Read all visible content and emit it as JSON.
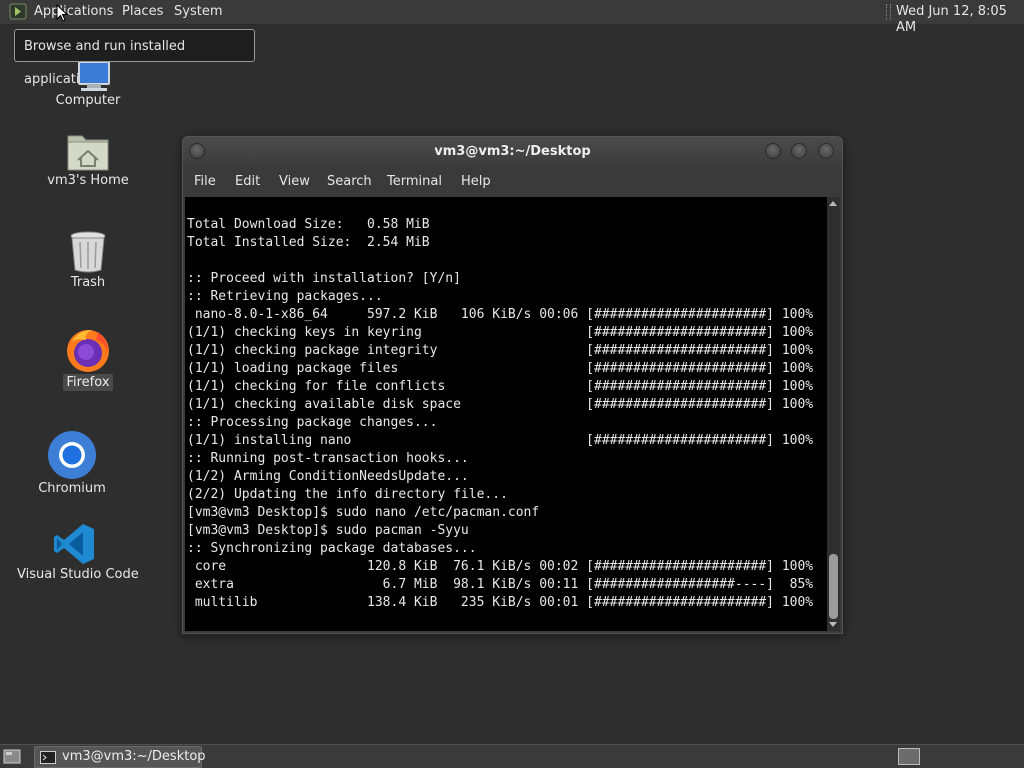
{
  "top_panel": {
    "menus": [
      "Applications",
      "Places",
      "System"
    ],
    "clock": "Wed Jun 12,  8:05 AM"
  },
  "tooltip": {
    "text": "Browse and run installed applications"
  },
  "desktop_icons": [
    {
      "label": "Computer",
      "icon": "computer-icon"
    },
    {
      "label": "vm3's Home",
      "icon": "home-folder-icon"
    },
    {
      "label": "Trash",
      "icon": "trash-icon"
    },
    {
      "label": "Firefox",
      "icon": "firefox-icon",
      "selected": true
    },
    {
      "label": "Chromium",
      "icon": "chromium-icon"
    },
    {
      "label": "Visual Studio Code",
      "icon": "vscode-icon"
    }
  ],
  "terminal_window": {
    "title": "vm3@vm3:~/Desktop",
    "menu": [
      "File",
      "Edit",
      "View",
      "Search",
      "Terminal",
      "Help"
    ],
    "lines": [
      "Total Download Size:   0.58 MiB",
      "Total Installed Size:  2.54 MiB",
      "",
      ":: Proceed with installation? [Y/n]",
      ":: Retrieving packages...",
      " nano-8.0-1-x86_64     597.2 KiB   106 KiB/s 00:06 [######################] 100%",
      "(1/1) checking keys in keyring                     [######################] 100%",
      "(1/1) checking package integrity                   [######################] 100%",
      "(1/1) loading package files                        [######################] 100%",
      "(1/1) checking for file conflicts                  [######################] 100%",
      "(1/1) checking available disk space                [######################] 100%",
      ":: Processing package changes...",
      "(1/1) installing nano                              [######################] 100%",
      ":: Running post-transaction hooks...",
      "(1/2) Arming ConditionNeedsUpdate...",
      "(2/2) Updating the info directory file...",
      "[vm3@vm3 Desktop]$ sudo nano /etc/pacman.conf",
      "[vm3@vm3 Desktop]$ sudo pacman -Syyu",
      ":: Synchronizing package databases...",
      " core                  120.8 KiB  76.1 KiB/s 00:02 [######################] 100%",
      " extra                   6.7 MiB  98.1 KiB/s 00:11 [##################----]  85%",
      " multilib              138.4 KiB   235 KiB/s 00:01 [######################] 100%"
    ]
  },
  "taskbar": {
    "task_label": "vm3@vm3:~/Desktop"
  },
  "colors": {
    "desktop_bg": "#2e2e2e",
    "panel_bg": "#3a3a3a",
    "terminal_bg": "#000000",
    "terminal_fg": "#e8e8e8"
  }
}
